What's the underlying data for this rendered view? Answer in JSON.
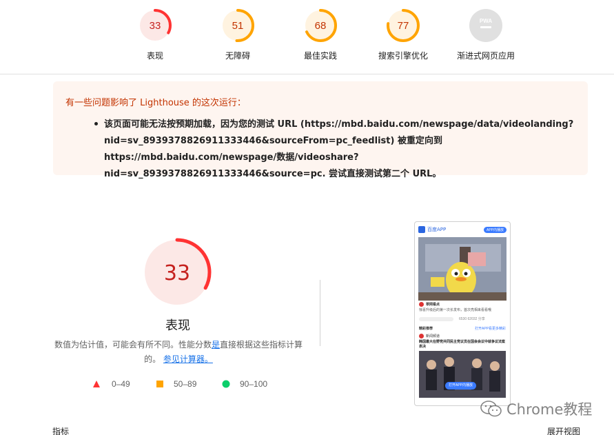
{
  "top_gauges": [
    {
      "score": "33",
      "label": "表现",
      "color": "#ff3333",
      "bg": "#fce8e6",
      "fraction": 0.33
    },
    {
      "score": "51",
      "label": "无障碍",
      "color": "#ffa400",
      "bg": "#fff3e0",
      "fraction": 0.51
    },
    {
      "score": "68",
      "label": "最佳实践",
      "color": "#ffa400",
      "bg": "#fff3e0",
      "fraction": 0.68
    },
    {
      "score": "77",
      "label": "搜索引擎优化",
      "color": "#ffa400",
      "bg": "#fff3e0",
      "fraction": 0.77
    },
    {
      "score": "PWA",
      "label": "渐进式网页应用",
      "color": "#cccccc",
      "bg": "#e0e0e0",
      "fraction": 0
    }
  ],
  "warning": {
    "title": "有一些问题影响了 Lighthouse 的这次运行：",
    "item": "该页面可能无法按预期加载，因为您的测试 URL (https://mbd.baidu.com/newspage/data/videolanding?nid=sv_8939378826911333446&sourceFrom=pc_feedlist) 被重定向到 https://mbd.baidu.com/newspage/数据/videoshare?nid=sv_8939378826911333446&source=pc. 尝试直接测试第二个 URL。"
  },
  "main_score": {
    "score": "33",
    "title": "表现",
    "fraction": 0.33,
    "color": "#eb0f00",
    "desc_pre": "数值为估计值，可能会有所不同。性能分数",
    "desc_link1": "是",
    "desc_mid": "直接根据这些指标计算的。",
    "desc_link2": "参见计算器。"
  },
  "legend": [
    {
      "range": "0–49",
      "shape": "triangle",
      "color": "#ff3333"
    },
    {
      "range": "50–89",
      "shape": "square",
      "color": "#ffa400"
    },
    {
      "range": "90–100",
      "shape": "circle",
      "color": "#0cce6b"
    }
  ],
  "phone": {
    "app_name": "百度APP",
    "open_btn": "APP内播放",
    "line1": "翠网看点",
    "line2": "惊喜升级后的第一次长发布，首次亮相来看看哦",
    "counts": "6530  62032  分享",
    "section": "精彩推荐",
    "section_link": "打开APP看更多精彩",
    "news_src": "新闻频道",
    "news_text": "韩国最大在野党共同民主党议员在国会会议中就争议法案表决",
    "open_app": "打开APP内播放"
  },
  "footer": {
    "left": "指标",
    "right": "展开视图"
  },
  "watermark": "Chrome教程"
}
